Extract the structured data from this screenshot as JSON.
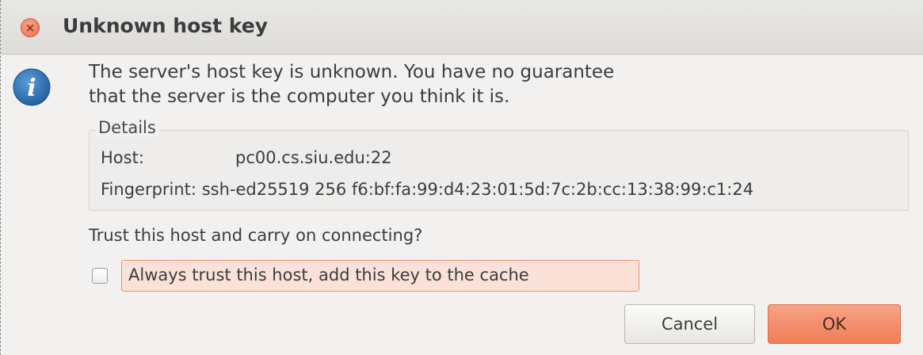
{
  "window": {
    "title": "Unknown host key",
    "close_glyph": "×"
  },
  "message": {
    "line1": "The server's host key is unknown. You have no guarantee",
    "line2": "that the server is the computer you think it is."
  },
  "details": {
    "legend": "Details",
    "host_label": "Host:",
    "host_value": "pc00.cs.siu.edu:22",
    "fingerprint_label": "Fingerprint:",
    "fingerprint_value": "ssh-ed25519 256 f6:bf:fa:99:d4:23:01:5d:7c:2b:cc:13:38:99:c1:24"
  },
  "question": "Trust this host and carry on connecting?",
  "checkbox": {
    "label": "Always trust this host, add this key to the cache",
    "checked": false
  },
  "buttons": {
    "cancel": "Cancel",
    "ok": "OK"
  },
  "colors": {
    "accent": "#ee7e58",
    "info_icon": "#2f6fb3"
  },
  "icons": {
    "close": "close-icon",
    "info": "info-icon"
  }
}
